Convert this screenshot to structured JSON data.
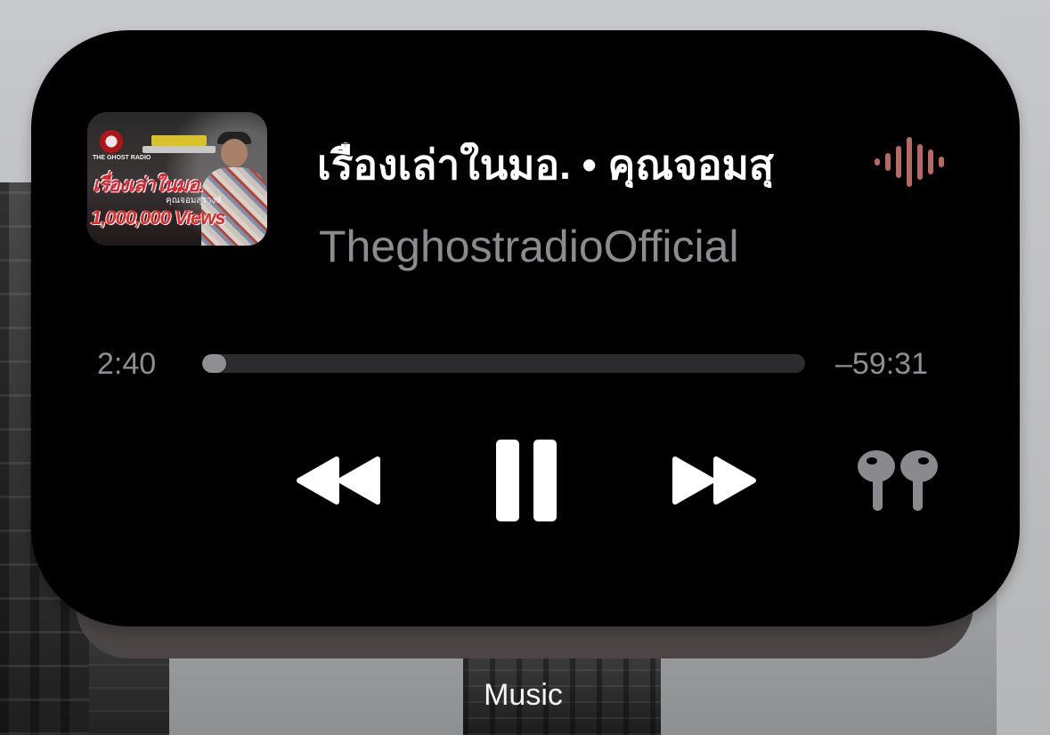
{
  "widget": {
    "title": "เรื่องเล่าในมอ. • คุณจอมสุ",
    "artist": "TheghostradioOfficial",
    "elapsed": "2:40",
    "remaining": "–59:31",
    "progress_fraction": 0.04,
    "artwork": {
      "logo_text": "THE GHOST RADIO",
      "title_text": "เรื่องเล่าในมอ.",
      "subtitle_text": "คุณจอมสุรางค์",
      "views_text": "1,000,000 Views"
    },
    "icons": {
      "waveform": "audio-waveform-icon",
      "rewind": "rewind-icon",
      "pause": "pause-icon",
      "forward": "fast-forward-icon",
      "output": "airpods-icon"
    },
    "colors": {
      "background": "#000000",
      "title": "#ffffff",
      "secondary": "#8b8b90",
      "waveform": "#b86a62"
    }
  },
  "app_label": "Music"
}
